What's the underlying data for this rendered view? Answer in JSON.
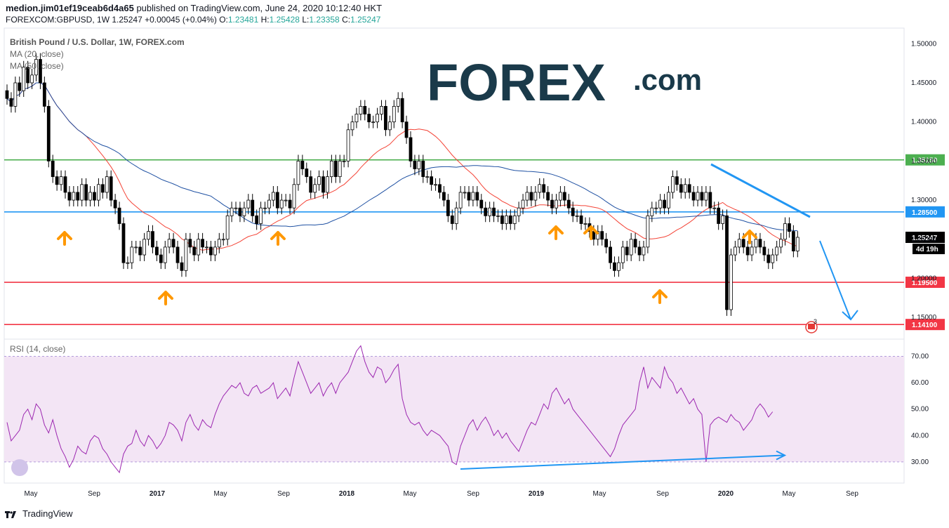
{
  "header": {
    "author": "medion.jim01ef19ceab6d4a65",
    "published": "published on TradingView.com, June 24, 2020 10:12:40 HKT",
    "symbol": "FOREXCOM:GBPUSD, 1W",
    "last": "1.25247",
    "change": "+0.00045 (+0.04%)",
    "o": "1.23481",
    "h": "1.25428",
    "l": "1.23358",
    "c": "1.25247"
  },
  "legend": {
    "title": "British Pound / U.S. Dollar, 1W, FOREX.com",
    "ma20": "MA (20, close)",
    "ma50": "MA (50, close)",
    "rsi": "RSI (14, close)"
  },
  "logo": {
    "main": "FOREX",
    "suffix": ".com"
  },
  "footer": {
    "brand": "TradingView"
  },
  "colors": {
    "up": "#ffffff",
    "down": "#000000",
    "ma20": "#f44336",
    "ma50": "#1e50a2",
    "resistance": "#4caf50",
    "level": "#2196f3",
    "support": "#f23645",
    "arrow": "#ff9800",
    "rsi": "#9c27b0",
    "rsi_band": "#f3e5f5"
  },
  "chart_data": {
    "type": "candlestick",
    "timeframe": "1W",
    "price_axis": {
      "ticks": [
        "1.15000",
        "1.20000",
        "1.25000",
        "1.30000",
        "1.35000",
        "1.40000",
        "1.45000",
        "1.50000"
      ],
      "range": [
        1.125,
        1.52
      ]
    },
    "time_axis": {
      "labels": [
        "May",
        "Sep",
        "2017",
        "May",
        "Sep",
        "2018",
        "May",
        "Sep",
        "2019",
        "May",
        "Sep",
        "2020",
        "May",
        "Sep"
      ]
    },
    "levels": [
      {
        "value": 1.3515,
        "label": "1.35150",
        "color": "#4caf50"
      },
      {
        "value": 1.285,
        "label": "1.28500",
        "color": "#2196f3"
      },
      {
        "value": 1.195,
        "label": "1.19500",
        "color": "#f23645"
      },
      {
        "value": 1.141,
        "label": "1.14100",
        "color": "#f23645"
      }
    ],
    "last_price": {
      "value": 1.25247,
      "label": "1.25247",
      "countdown": "4d 19h"
    },
    "event_badge": "3",
    "closes": [
      1.43,
      1.42,
      1.45,
      1.44,
      1.47,
      1.45,
      1.46,
      1.48,
      1.45,
      1.42,
      1.35,
      1.33,
      1.32,
      1.33,
      1.31,
      1.3,
      1.31,
      1.3,
      1.32,
      1.3,
      1.31,
      1.3,
      1.32,
      1.31,
      1.33,
      1.3,
      1.29,
      1.27,
      1.22,
      1.22,
      1.24,
      1.24,
      1.23,
      1.25,
      1.26,
      1.24,
      1.23,
      1.22,
      1.24,
      1.25,
      1.24,
      1.22,
      1.21,
      1.25,
      1.24,
      1.23,
      1.25,
      1.24,
      1.24,
      1.23,
      1.24,
      1.25,
      1.25,
      1.28,
      1.29,
      1.29,
      1.28,
      1.29,
      1.3,
      1.28,
      1.27,
      1.29,
      1.29,
      1.3,
      1.31,
      1.29,
      1.3,
      1.3,
      1.29,
      1.32,
      1.35,
      1.34,
      1.33,
      1.31,
      1.32,
      1.33,
      1.31,
      1.33,
      1.35,
      1.33,
      1.35,
      1.35,
      1.39,
      1.4,
      1.41,
      1.42,
      1.41,
      1.4,
      1.4,
      1.41,
      1.42,
      1.39,
      1.4,
      1.42,
      1.43,
      1.4,
      1.38,
      1.35,
      1.34,
      1.35,
      1.33,
      1.33,
      1.32,
      1.32,
      1.31,
      1.3,
      1.28,
      1.27,
      1.29,
      1.31,
      1.31,
      1.3,
      1.31,
      1.3,
      1.29,
      1.28,
      1.29,
      1.28,
      1.28,
      1.27,
      1.28,
      1.27,
      1.28,
      1.29,
      1.3,
      1.31,
      1.3,
      1.31,
      1.32,
      1.31,
      1.3,
      1.29,
      1.3,
      1.31,
      1.3,
      1.29,
      1.28,
      1.28,
      1.27,
      1.27,
      1.26,
      1.25,
      1.26,
      1.25,
      1.24,
      1.22,
      1.21,
      1.22,
      1.24,
      1.23,
      1.25,
      1.24,
      1.23,
      1.24,
      1.28,
      1.29,
      1.29,
      1.3,
      1.29,
      1.31,
      1.33,
      1.32,
      1.31,
      1.32,
      1.31,
      1.3,
      1.31,
      1.3,
      1.31,
      1.29,
      1.29,
      1.27,
      1.28,
      1.16,
      1.23,
      1.24,
      1.25,
      1.24,
      1.23,
      1.24,
      1.25,
      1.24,
      1.23,
      1.22,
      1.23,
      1.24,
      1.25,
      1.27,
      1.26,
      1.235,
      1.25247
    ],
    "ma20_series_name": "MA (20, close)",
    "ma50_series_name": "MA (50, close)",
    "rsi": {
      "axis_ticks": [
        "30.00",
        "40.00",
        "50.00",
        "60.00",
        "70.00"
      ],
      "range": [
        22,
        76
      ],
      "band": [
        30,
        70
      ],
      "values": [
        45,
        38,
        40,
        42,
        48,
        50,
        46,
        52,
        50,
        44,
        41,
        46,
        40,
        35,
        32,
        28,
        31,
        36,
        34,
        33,
        38,
        40,
        39,
        35,
        33,
        30,
        28,
        26,
        33,
        36,
        37,
        42,
        38,
        36,
        40,
        38,
        35,
        37,
        40,
        45,
        44,
        42,
        38,
        45,
        48,
        44,
        42,
        46,
        44,
        43,
        48,
        52,
        55,
        57,
        59,
        58,
        60,
        56,
        55,
        58,
        59,
        56,
        57,
        58,
        60,
        54,
        56,
        58,
        55,
        62,
        68,
        64,
        60,
        56,
        58,
        60,
        55,
        58,
        60,
        56,
        60,
        62,
        64,
        68,
        72,
        74,
        68,
        64,
        62,
        66,
        65,
        60,
        62,
        65,
        67,
        54,
        48,
        45,
        44,
        45,
        42,
        40,
        42,
        41,
        40,
        38,
        36,
        30,
        29,
        36,
        40,
        44,
        46,
        42,
        45,
        47,
        44,
        40,
        42,
        39,
        41,
        38,
        36,
        34,
        38,
        42,
        45,
        44,
        48,
        52,
        50,
        56,
        58,
        55,
        52,
        54,
        50,
        48,
        46,
        44,
        42,
        40,
        38,
        36,
        34,
        32,
        35,
        40,
        44,
        46,
        48,
        50,
        60,
        66,
        58,
        62,
        60,
        58,
        66,
        62,
        60,
        56,
        58,
        55,
        52,
        54,
        50,
        48,
        30,
        44,
        46,
        47,
        46,
        45,
        48,
        46,
        45,
        42,
        44,
        46,
        50,
        52,
        50,
        47,
        49
      ],
      "trendline": [
        30.5,
        32.5
      ]
    }
  }
}
